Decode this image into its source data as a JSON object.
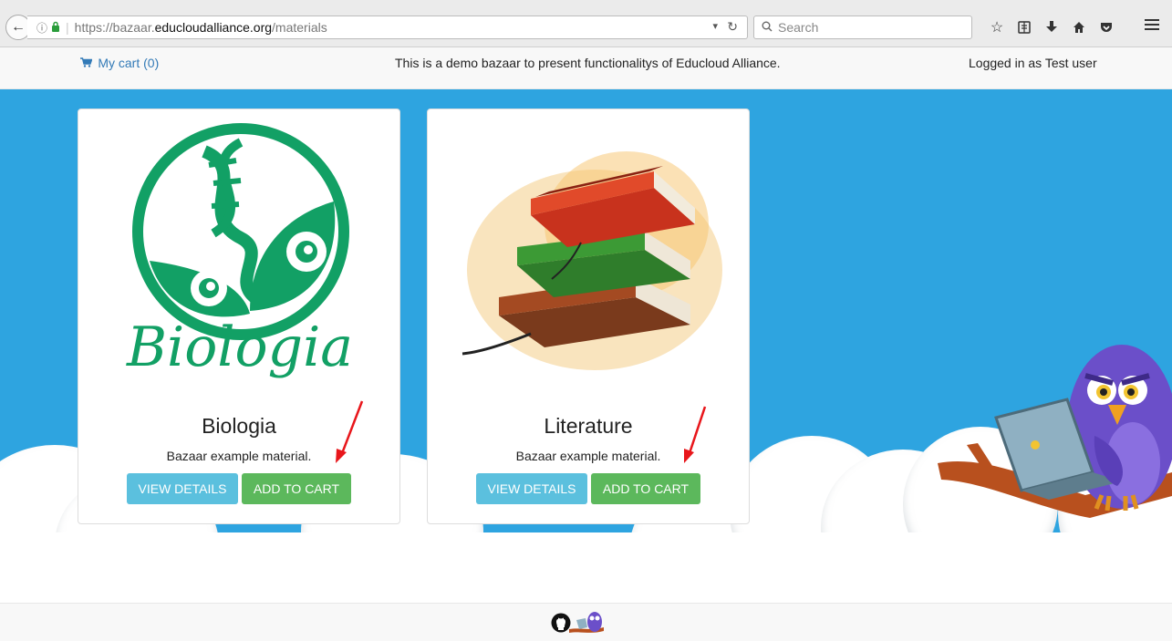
{
  "browser": {
    "url_prefix": "https://bazaar.",
    "url_domain": "educloudalliance.org",
    "url_path": "/materials",
    "search_placeholder": "Search",
    "info_glyph": "ⓘ",
    "lock_glyph": "🔒",
    "dropdown_glyph": "⌄",
    "reload_glyph": "C"
  },
  "nav": {
    "cart_label": "My cart (0)",
    "demo_message": "This is a demo bazaar to present functionalitys of Educloud Alliance.",
    "logged_in": "Logged in as Test user"
  },
  "materials": [
    {
      "title": "Biologia",
      "description": "Bazaar example material.",
      "details_label": "VIEW DETAILS",
      "cart_label": "ADD TO CART",
      "logo_text": "Biologia"
    },
    {
      "title": "Literature",
      "description": "Bazaar example material.",
      "details_label": "VIEW DETAILS",
      "cart_label": "ADD TO CART"
    }
  ],
  "colors": {
    "hero_bg": "#2ea4e0",
    "link": "#337ab7",
    "info_button": "#5bc0de",
    "success_button": "#5cb85c",
    "biologia_green": "#12a065",
    "annotation_red": "#e8161b"
  }
}
